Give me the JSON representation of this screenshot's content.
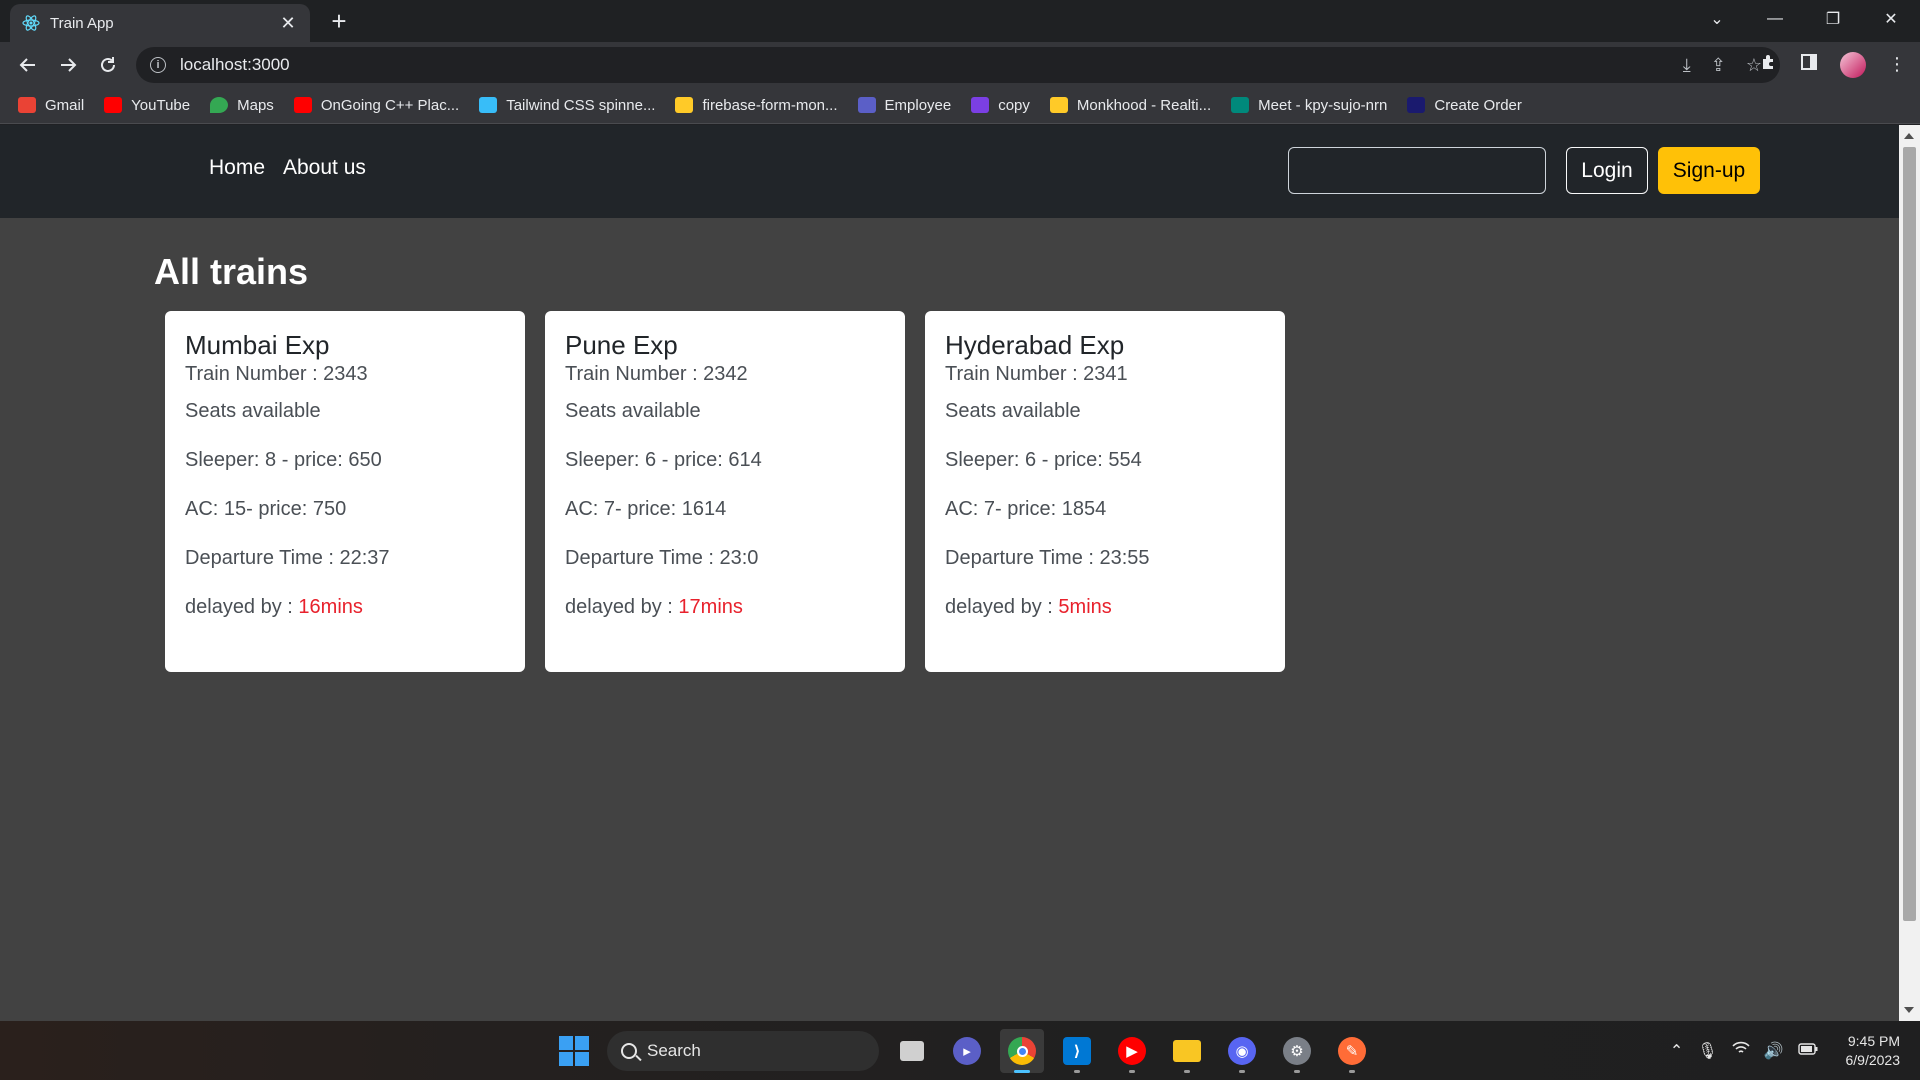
{
  "browser": {
    "tab_title": "Train App",
    "tab_close": "✕",
    "new_tab": "+",
    "url": "localhost:3000",
    "window_controls": {
      "minimize": "—",
      "maximize": "❐",
      "close": "✕",
      "tab_search": "⌄"
    },
    "bookmarks": [
      {
        "label": "Gmail",
        "color": "#ea4335"
      },
      {
        "label": "YouTube",
        "color": "#ff0000"
      },
      {
        "label": "Maps",
        "color": "#34a853"
      },
      {
        "label": "OnGoing C++ Plac...",
        "color": "#ff0000"
      },
      {
        "label": "Tailwind CSS spinne...",
        "color": "#38bdf8"
      },
      {
        "label": "firebase-form-mon...",
        "color": "#ffca28"
      },
      {
        "label": "Employee",
        "color": "#5b5fc7"
      },
      {
        "label": "copy",
        "color": "#7b3fe4"
      },
      {
        "label": "Monkhood - Realti...",
        "color": "#ffca28"
      },
      {
        "label": "Meet - kpy-sujo-nrn",
        "color": "#00897b"
      },
      {
        "label": "Create Order",
        "color": "#1a1a6e"
      }
    ]
  },
  "navbar": {
    "links": [
      "Home",
      "About us"
    ],
    "search_value": "",
    "login_label": "Login",
    "signup_label": "Sign-up"
  },
  "page": {
    "heading": "All trains"
  },
  "trains": [
    {
      "name": "Mumbai Exp",
      "number_label": "Train Number : 2343",
      "seats_label": "Seats available",
      "sleeper": "Sleeper: 8 - price: 650",
      "ac": "AC: 15- price: 750",
      "departure": "Departure Time : 22:37",
      "delay_prefix": "delayed by : ",
      "delay_value": "16mins"
    },
    {
      "name": "Pune Exp",
      "number_label": "Train Number : 2342",
      "seats_label": "Seats available",
      "sleeper": "Sleeper: 6 - price: 614",
      "ac": "AC: 7- price: 1614",
      "departure": "Departure Time : 23:0",
      "delay_prefix": "delayed by : ",
      "delay_value": "17mins"
    },
    {
      "name": "Hyderabad Exp",
      "number_label": "Train Number : 2341",
      "seats_label": "Seats available",
      "sleeper": "Sleeper: 6 - price: 554",
      "ac": "AC: 7- price: 1854",
      "departure": "Departure Time : 23:55",
      "delay_prefix": "delayed by : ",
      "delay_value": "5mins"
    }
  ],
  "taskbar": {
    "search_label": "Search",
    "time": "9:45 PM",
    "date": "6/9/2023"
  },
  "colors": {
    "page_bg": "#424242",
    "navbar_bg": "#212529",
    "signup_bg": "#ffc107",
    "delay_text": "#e8212c"
  }
}
